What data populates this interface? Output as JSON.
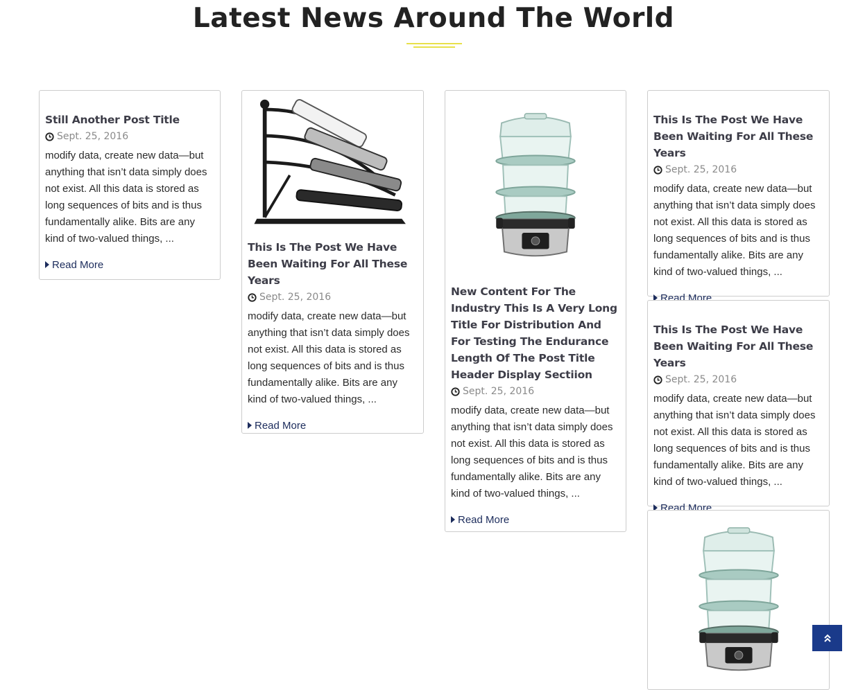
{
  "section": {
    "title": "Latest News Around The World"
  },
  "cards": [
    {
      "title": "Still Another Post Title",
      "date": "Sept. 25, 2016",
      "excerpt": "modify data, create new data—but anything that isn’t data simply does not exist. All this data is stored as long sequences of bits and is thus fundamentally alike. Bits are any kind of two-valued things, ...",
      "read_more": "Read More"
    },
    {
      "image": "remote-control-holder-image",
      "title": "This Is The Post We Have Been Waiting For All These Years",
      "date": "Sept. 25, 2016",
      "excerpt": "modify data, create new data—but anything that isn’t data simply does not exist. All this data is stored as long sequences of bits and is thus fundamentally alike. Bits are any kind of two-valued things, ...",
      "read_more": "Read More"
    },
    {
      "image": "food-steamer-image",
      "title": "New Content For The Industry This Is A Very Long Title For Distribution And For Testing The Endurance Length Of The Post Title Header Display Sectiion",
      "date": "Sept. 25, 2016",
      "excerpt": "modify data, create new data—but anything that isn’t data simply does not exist. All this data is stored as long sequences of bits and is thus fundamentally alike. Bits are any kind of two-valued things, ...",
      "read_more": "Read More"
    },
    {
      "title": "This Is The Post We Have Been Waiting For All These Years",
      "date": "Sept. 25, 2016",
      "excerpt": "modify data, create new data—but anything that isn’t data simply does not exist. All this data is stored as long sequences of bits and is thus fundamentally alike. Bits are any kind of two-valued things, ...",
      "read_more": "Read More"
    },
    {
      "title": "This Is The Post We Have Been Waiting For All These Years",
      "date": "Sept. 25, 2016",
      "excerpt": "modify data, create new data—but anything that isn’t data simply does not exist. All this data is stored as long sequences of bits and is thus fundamentally alike. Bits are any kind of two-valued things, ...",
      "read_more": "Read More"
    },
    {
      "image": "food-steamer-image"
    }
  ],
  "scroll_top": {
    "icon": "double-chevron-up-icon"
  },
  "colors": {
    "accent_underline": "#e8e04a",
    "link": "#1c2c5c",
    "scroll_button": "#1a3a8a"
  }
}
